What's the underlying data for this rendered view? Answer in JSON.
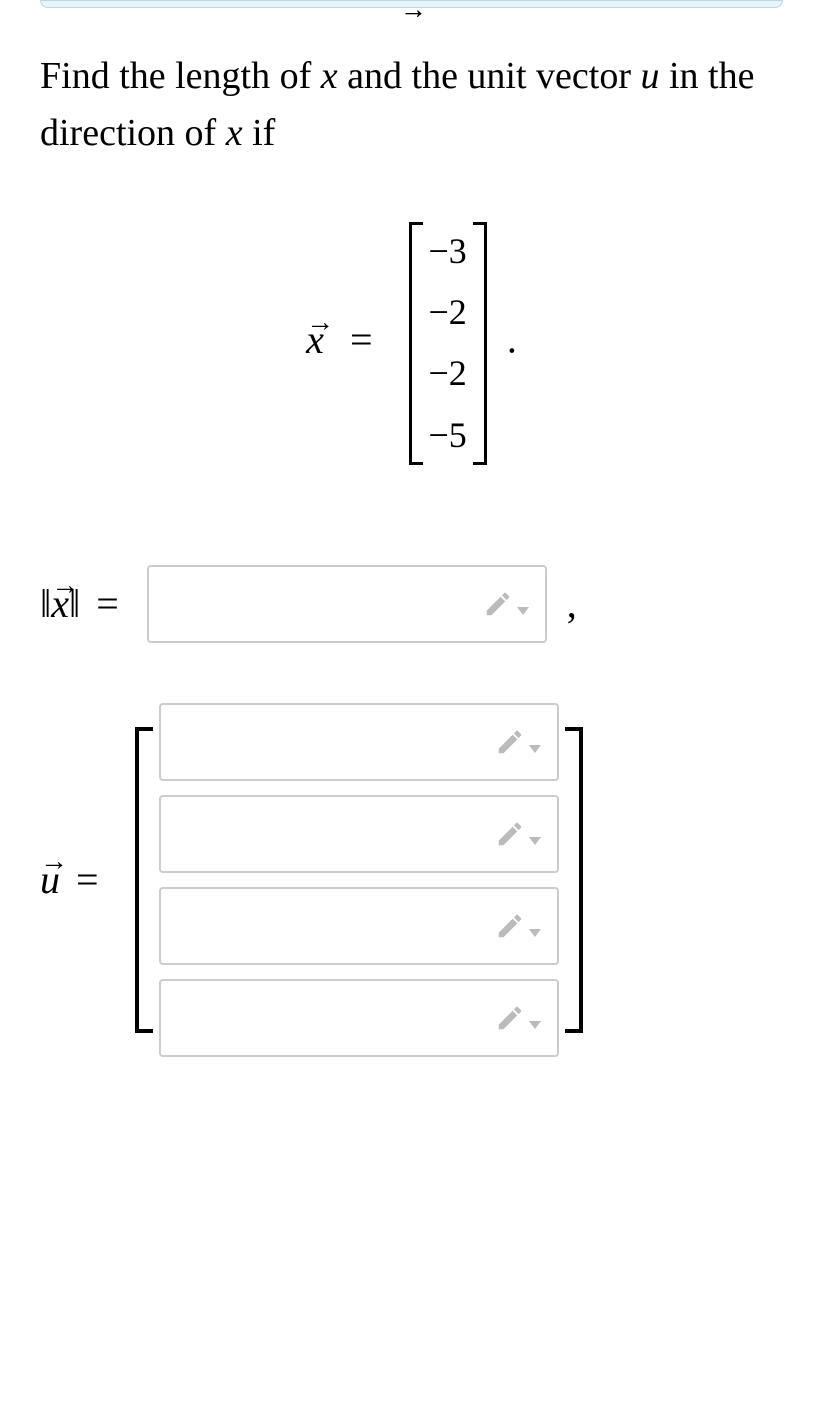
{
  "prompt": {
    "part1": "Find the length of ",
    "var_x": "x",
    "part2": " and the unit vector ",
    "var_u": "u",
    "part3": " in the direction of ",
    "part4": " if"
  },
  "equation": {
    "lhs_var": "x",
    "vector_values": [
      "−3",
      "−2",
      "−2",
      "−5"
    ],
    "period": "."
  },
  "norm": {
    "var": "x",
    "equals": "=",
    "comma": ","
  },
  "unit_vector": {
    "var": "u",
    "equals": "="
  }
}
